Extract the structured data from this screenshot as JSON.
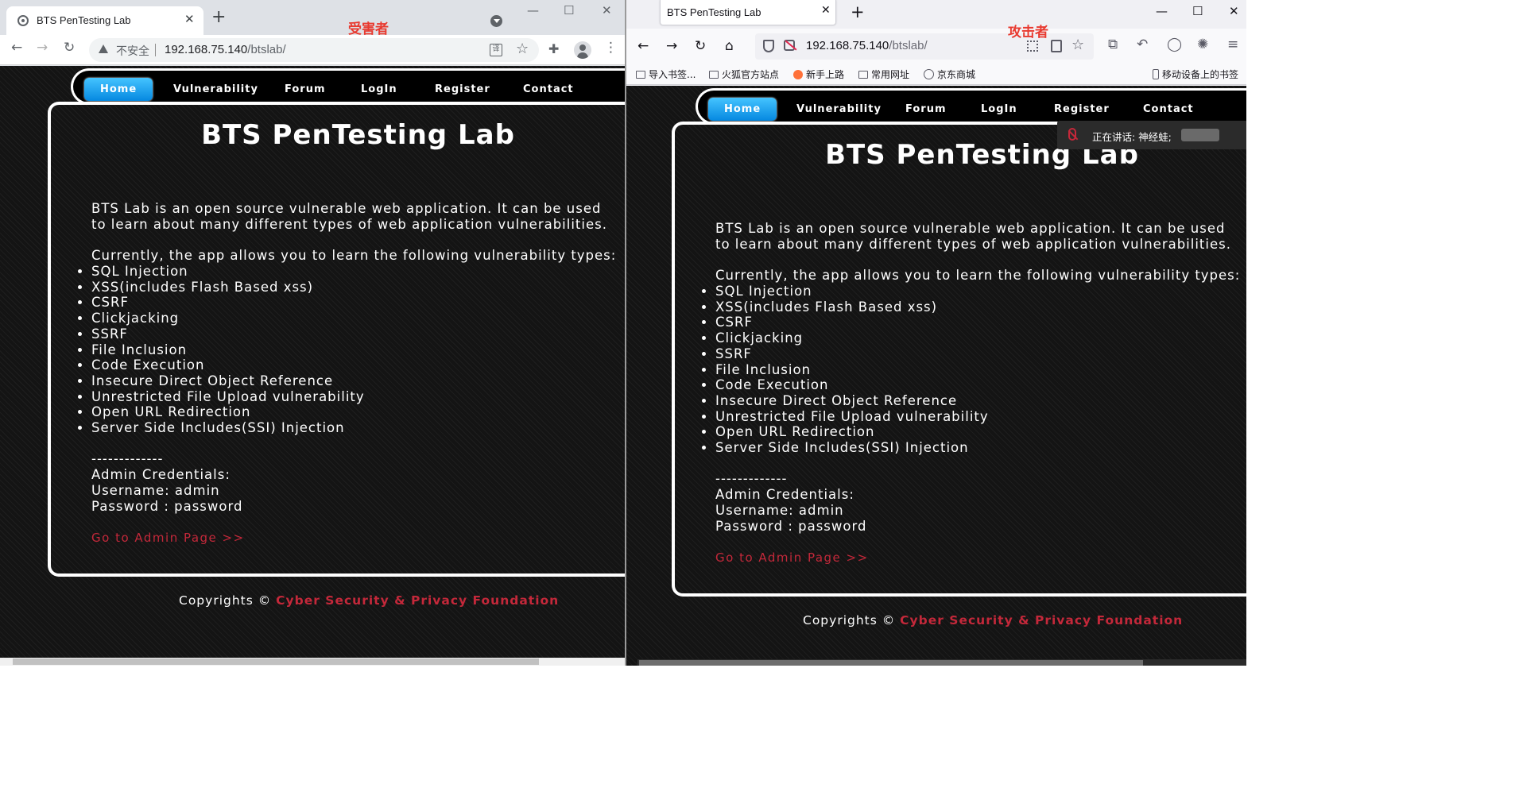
{
  "victim_window": {
    "tab_title": "BTS PenTesting Lab",
    "tab_close": "✕",
    "new_tab": "+",
    "role_label": "受害者",
    "nav_back": "←",
    "nav_forward": "→",
    "nav_reload": "↻",
    "security_label": "不安全",
    "url_host": "192.168.75.140",
    "url_path": "/btslab/",
    "translate_icon": "译",
    "bookmark_icon": "☆",
    "extensions_icon": "✚",
    "menu_icon": "⋮",
    "win_min": "—",
    "win_max": "☐",
    "win_close": "✕"
  },
  "attacker_window": {
    "tab_title": "BTS PenTesting Lab",
    "tab_close": "✕",
    "new_tab": "+",
    "role_label": "攻击者",
    "nav_back": "←",
    "nav_forward": "→",
    "nav_reload": "↻",
    "nav_home": "⌂",
    "url_host": "192.168.75.140",
    "url_path": "/btslab/",
    "bookmark_icon": "☆",
    "screenshot_icon": "⧉",
    "undo_icon": "↶",
    "circle_icon": "◯",
    "ext_icon": "✺",
    "menu_icon": "≡",
    "win_min": "—",
    "win_max": "☐",
    "win_close": "✕",
    "bookmarks_bar": [
      "导入书签...",
      "火狐官方站点",
      "新手上路",
      "常用网址",
      "京东商城"
    ],
    "mobile_bookmarks": "移动设备上的书签",
    "speaking_notice": "正在讲话: 神经蛙;"
  },
  "site": {
    "nav": [
      "Home",
      "Vulnerability",
      "Forum",
      "LogIn",
      "Register",
      "Contact"
    ],
    "title": "BTS PenTesting Lab",
    "intro_line1": "BTS Lab is an open source vulnerable web application. It can be used",
    "intro_line2": "to learn about many different types of web application vulnerabilities.",
    "list_intro": "Currently, the app allows you to learn the following vulnerability types:",
    "vulnerabilities": [
      "SQL Injection",
      "XSS(includes Flash Based xss)",
      "CSRF",
      "Clickjacking",
      "SSRF",
      "File Inclusion",
      "Code Execution",
      "Insecure Direct Object Reference",
      "Unrestricted File Upload vulnerability",
      "Open URL Redirection",
      "Server Side Includes(SSI) Injection"
    ],
    "separator": "-------------",
    "admin_heading": "Admin Credentials:",
    "username_line": "Username: admin",
    "password_line": "Password : password",
    "admin_link": "Go to Admin Page >>",
    "copyright_prefix": "Copyrights © ",
    "copyright_org": "Cyber Security & Privacy Foundation"
  },
  "colors": {
    "link_red": "#c4283a",
    "annotation_red": "#e83a30",
    "home_button": "#0a9cf0",
    "page_bg": "#141414"
  }
}
